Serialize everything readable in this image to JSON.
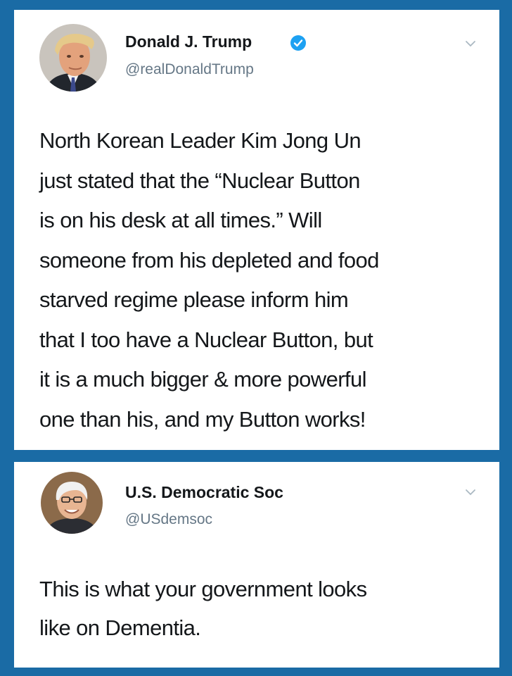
{
  "tweets": [
    {
      "display_name": "Donald J. Trump",
      "handle": "@realDonaldTrump",
      "verified": true,
      "avatar_icon": "avatar-photo-icon",
      "text_lines": [
        "North Korean Leader Kim Jong Un",
        "just stated that the “Nuclear Button",
        "is on his desk at all times.” Will",
        "someone from his depleted and food",
        "starved regime please inform him",
        "that I too have a Nuclear Button, but",
        "it is a much bigger & more powerful",
        "one than his, and my Button works!"
      ]
    },
    {
      "display_name": "U.S. Democratic Soc",
      "handle": "@USdemsoc",
      "verified": false,
      "avatar_icon": "avatar-photo-icon",
      "text_lines": [
        "This is what your government looks",
        "like on Dementia."
      ]
    }
  ],
  "colors": {
    "background": "#1a6ba5",
    "card": "#ffffff",
    "text": "#14171a",
    "secondary_text": "#657786",
    "verified_badge": "#1da1f2"
  }
}
